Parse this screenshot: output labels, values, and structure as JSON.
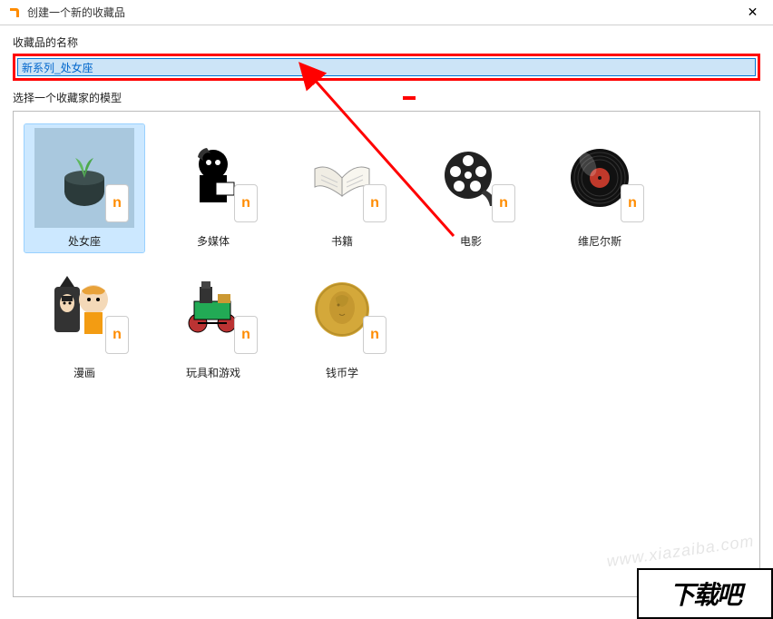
{
  "titlebar": {
    "title": "创建一个新的收藏品",
    "close_symbol": "✕"
  },
  "labels": {
    "name_label": "收藏品的名称",
    "model_label": "选择一个收藏家的模型"
  },
  "input": {
    "name_value": "新系列_处女座"
  },
  "models": [
    {
      "label": "处女座",
      "selected": true,
      "icon": "plant"
    },
    {
      "label": "多媒体",
      "selected": false,
      "icon": "media"
    },
    {
      "label": "书籍",
      "selected": false,
      "icon": "book"
    },
    {
      "label": "电影",
      "selected": false,
      "icon": "film"
    },
    {
      "label": "维尼尔斯",
      "selected": false,
      "icon": "vinyl"
    },
    {
      "label": "漫画",
      "selected": false,
      "icon": "comic"
    },
    {
      "label": "玩具和游戏",
      "selected": false,
      "icon": "toy"
    },
    {
      "label": "钱币学",
      "selected": false,
      "icon": "coin"
    }
  ],
  "watermark": "www.xiazaiba.com",
  "bottom_logo": "下载吧",
  "badge_letter": "n"
}
